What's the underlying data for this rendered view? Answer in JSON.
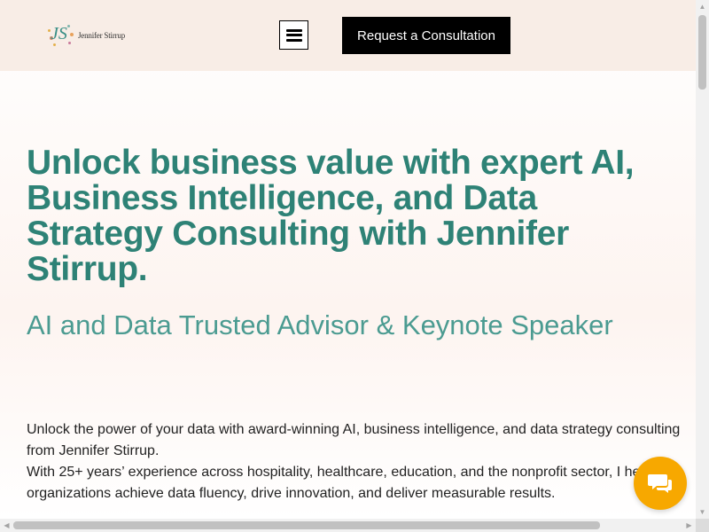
{
  "header": {
    "logo_initials": "JS",
    "logo_name": "Jennifer Stirrup",
    "menu_icon": "hamburger-icon",
    "cta_label": "Request a Consultation",
    "background_color": "#f8ede6"
  },
  "hero": {
    "headline": "Unlock business value with expert AI, Business Intelligence, and Data Strategy Consulting with Jennifer Stirrup.",
    "subheadline": "AI and Data Trusted Advisor & Keynote Speaker",
    "paragraph_1": "Unlock the power of your data with award-winning AI, business intelligence, and data strategy consulting from Jennifer Stirrup.",
    "paragraph_2": "With 25+ years’ experience across hospitality, healthcare, education, and the nonprofit sector, I help organizations achieve data fluency, drive innovation, and deliver measurable results.",
    "headline_color": "#2e8276",
    "subheadline_color": "#4b9b91"
  },
  "chat_widget": {
    "icon": "chat-icon",
    "color": "#f7a800"
  },
  "scrollbars": {
    "vertical_up": "▲",
    "vertical_down": "▼",
    "horizontal_left": "◀",
    "horizontal_right": "▶"
  }
}
